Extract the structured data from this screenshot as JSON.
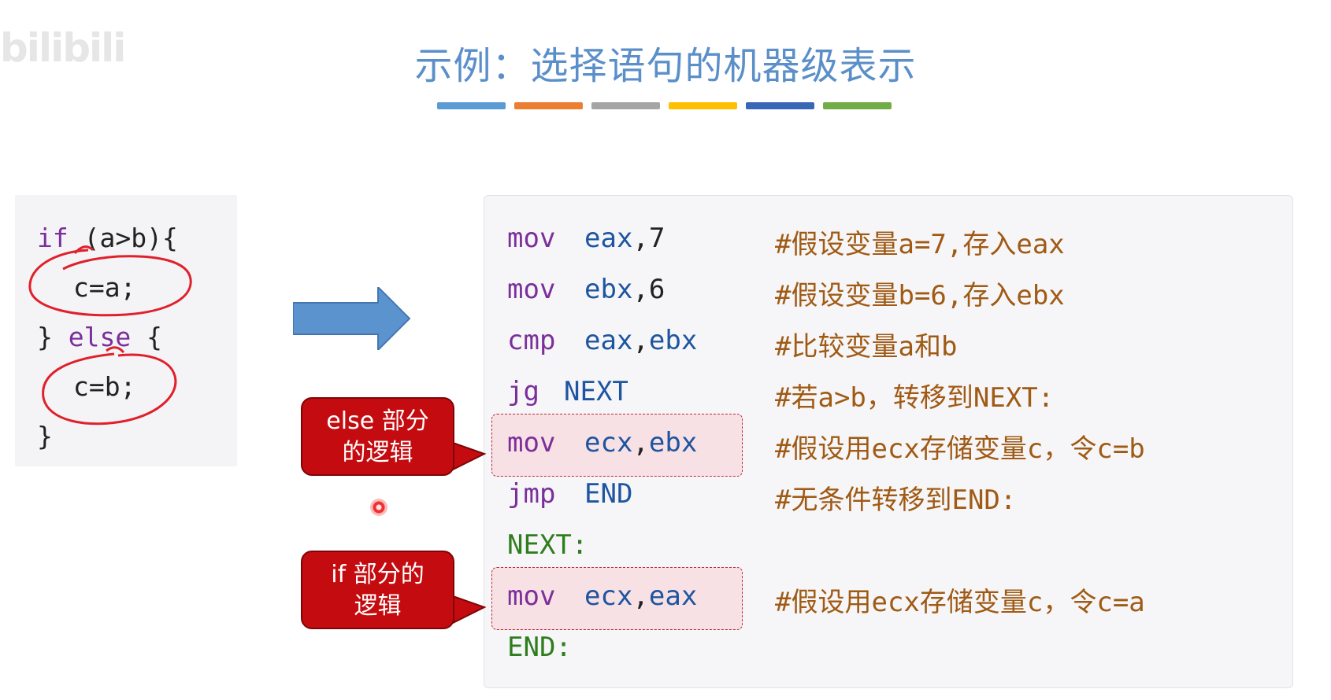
{
  "watermark": "bilibili",
  "title": "示例：选择语句的机器级表示",
  "color_segments": [
    "#5b9bd5",
    "#ed7d31",
    "#a5a5a5",
    "#ffc000",
    "#3a66b8",
    "#70ad47"
  ],
  "c_code": {
    "line1": {
      "kw": "if",
      "rest": " (a>b){"
    },
    "line2": "c=a;",
    "line3": {
      "pre": "} ",
      "kw": "else",
      "rest": " {"
    },
    "line4": "c=b;",
    "line5": "}"
  },
  "asm": [
    {
      "op": "mov",
      "args": "eax",
      "sep": ",",
      "val": "7",
      "comment": "#假设变量a=7,存入eax"
    },
    {
      "op": "mov",
      "args": "ebx",
      "sep": ",",
      "val": "6",
      "comment": "#假设变量b=6,存入ebx"
    },
    {
      "op": "cmp",
      "args": "eax",
      "sep": ",",
      "val": "ebx",
      "comment": "#比较变量a和b"
    },
    {
      "op": "jg",
      "args": "NEXT",
      "sep": "",
      "val": "",
      "comment": "#若a>b，转移到NEXT:"
    },
    {
      "op": "mov",
      "args": "ecx",
      "sep": ",",
      "val": "ebx",
      "comment": "#假设用ecx存储变量c，令c=b"
    },
    {
      "op": "jmp",
      "args": "END",
      "sep": "",
      "val": "",
      "comment": "#无条件转移到END:"
    },
    {
      "label": "NEXT:"
    },
    {
      "op": "mov",
      "args": "ecx",
      "sep": ",",
      "val": "eax",
      "comment": "#假设用ecx存储变量c，令c=a"
    },
    {
      "label": "END:"
    }
  ],
  "callouts": {
    "else_logic": {
      "line1": "else 部分",
      "line2": "的逻辑"
    },
    "if_logic": {
      "line1": "if 部分的",
      "line2": "逻辑"
    }
  }
}
